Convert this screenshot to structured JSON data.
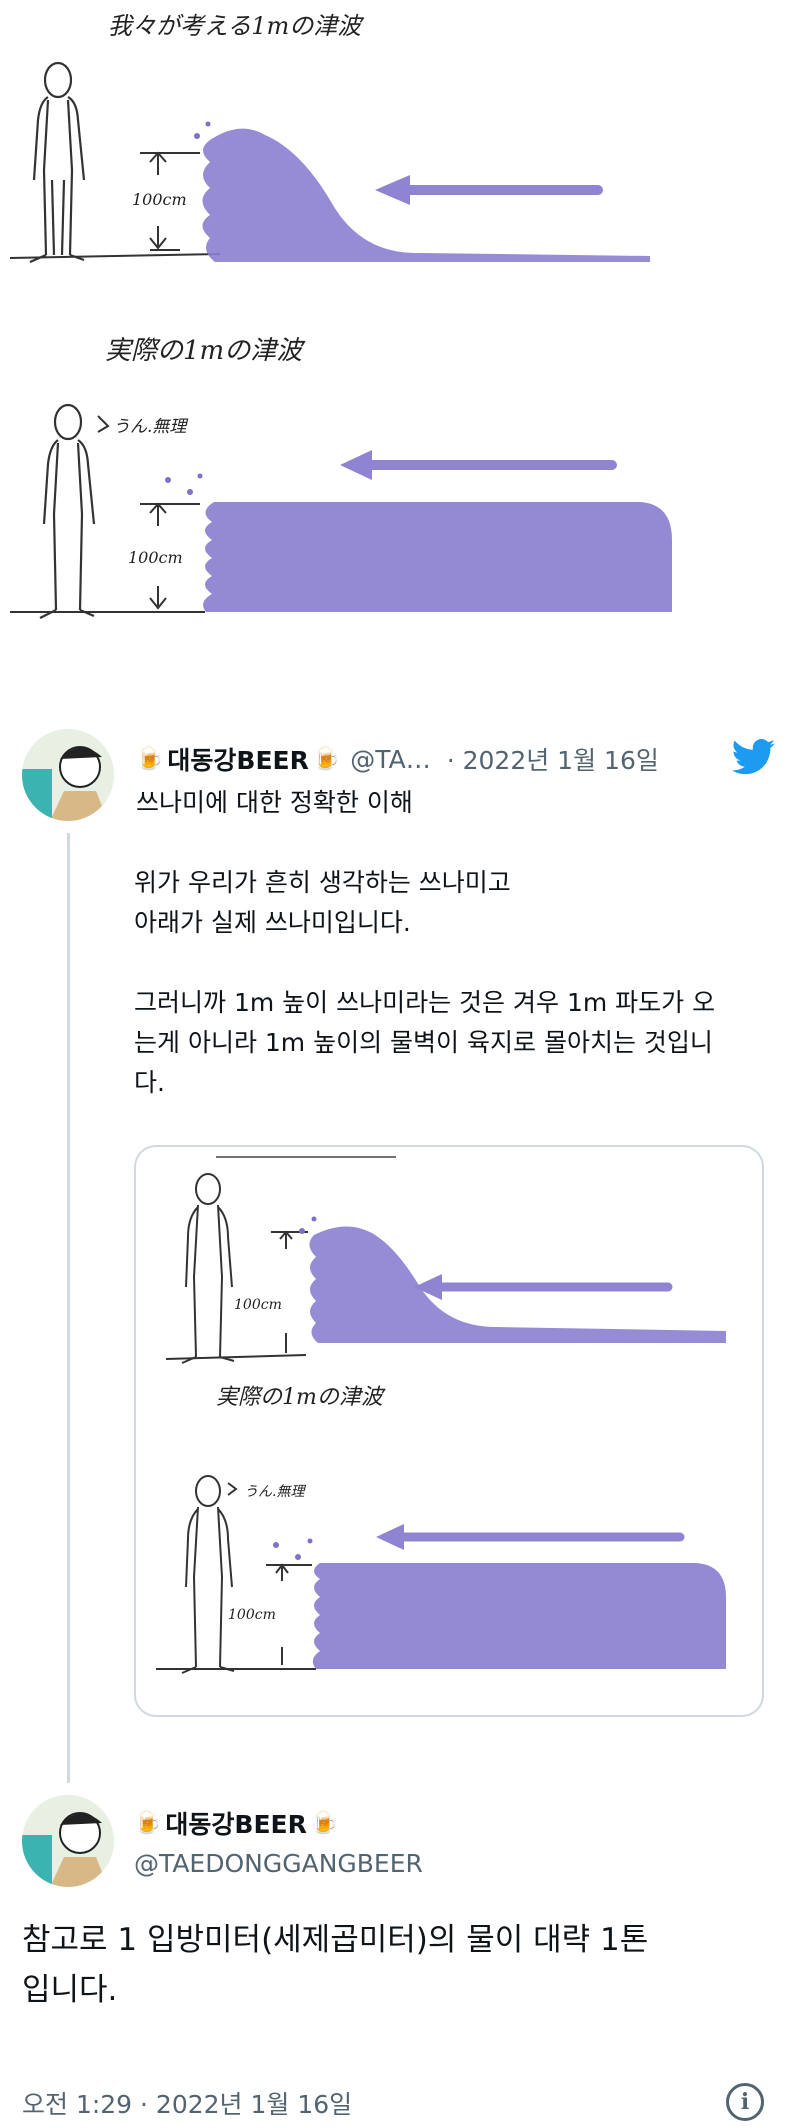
{
  "illustration": {
    "top_title": "我々が考える1mの津波",
    "bottom_title": "実際の1mの津波",
    "height_label": "100cm",
    "speech": "うん.無理"
  },
  "tweet1": {
    "name": "대동강BEER",
    "handle": "@TA…",
    "date": "· 2022년 1월 16일",
    "title_line": "쓰나미에 대한 정확한 이해",
    "body": [
      "위가 우리가 흔히 생각하는 쓰나미고",
      "아래가 실제 쓰나미입니다.",
      "",
      "그러니까 1m 높이 쓰나미라는 것은 겨우 1m 파도가 오",
      "는게 아니라 1m 높이의 물벽이 육지로 몰아치는 것입니",
      "다."
    ]
  },
  "tweet2": {
    "name": "대동강BEER",
    "handle": "@TAEDONGGANGBEER",
    "body_lines": [
      "참고로 1 입방미터(세제곱미터)의 물이 대략 1톤",
      "입니다."
    ],
    "timestamp": "오전 1:29 · 2022년 1월 16일"
  },
  "icons": {
    "twitter": "twitter-bird-icon",
    "beer": "beer-mug-icon",
    "info": "info-icon"
  },
  "colors": {
    "wave": "#8b80d0",
    "arrow": "#8e84d2",
    "twitter_blue": "#1d9bf0"
  },
  "info_glyph": "i"
}
